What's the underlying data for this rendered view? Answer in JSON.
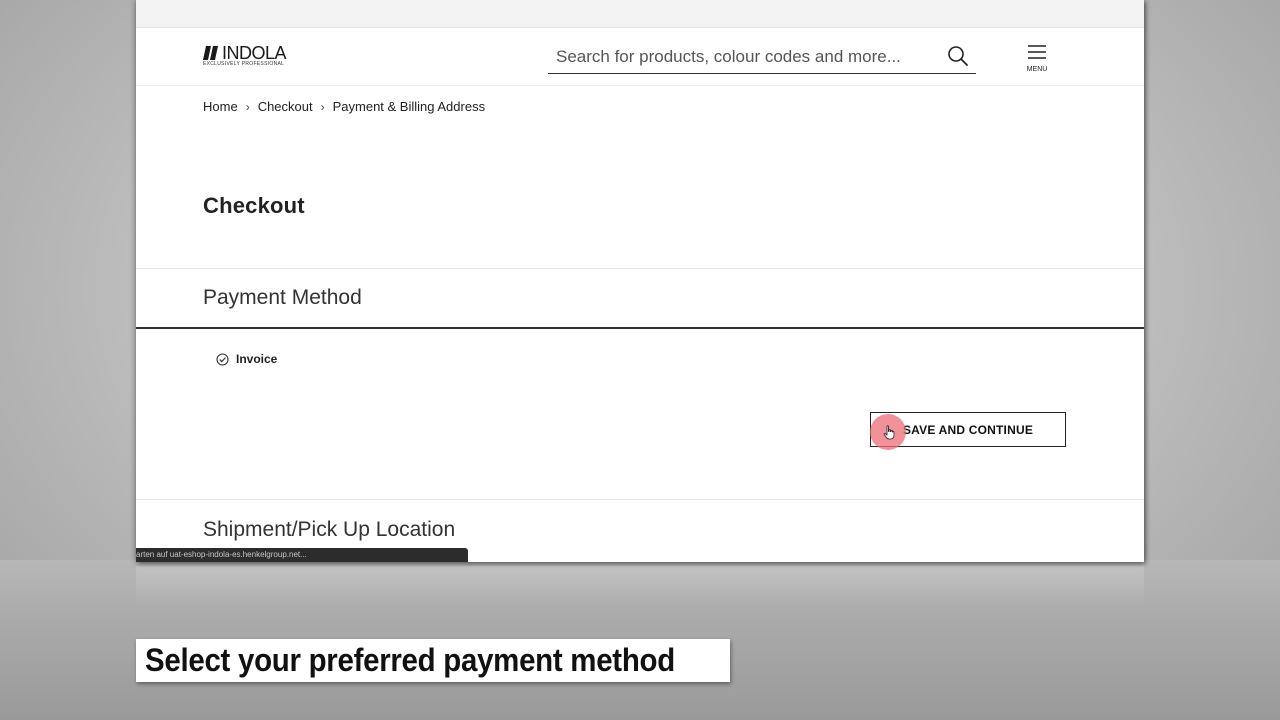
{
  "header": {
    "logo_word": "INDOLA",
    "logo_tagline": "EXCLUSIVELY PROFESSIONAL",
    "search_placeholder": "Search for products, colour codes and more...",
    "menu_label": "MENU"
  },
  "breadcrumb": [
    "Home",
    "Checkout",
    "Payment & Billing Address"
  ],
  "page_title": "Checkout",
  "payment": {
    "heading": "Payment Method",
    "option_label": "Invoice",
    "button_label": "SAVE AND CONTINUE"
  },
  "shipment": {
    "heading": "Shipment/Pick Up Location"
  },
  "status_bar": "arten auf uat-eshop-indola-es.henkelgroup.net...",
  "caption": "Select your preferred payment method",
  "colors": {
    "cursor_halo": "#ec6e78",
    "text_dark": "#222222",
    "rule_dark": "#333333"
  },
  "icons": [
    "search-icon",
    "menu-icon",
    "chevron-right-icon",
    "check-circle-icon",
    "hand-pointer-icon"
  ]
}
